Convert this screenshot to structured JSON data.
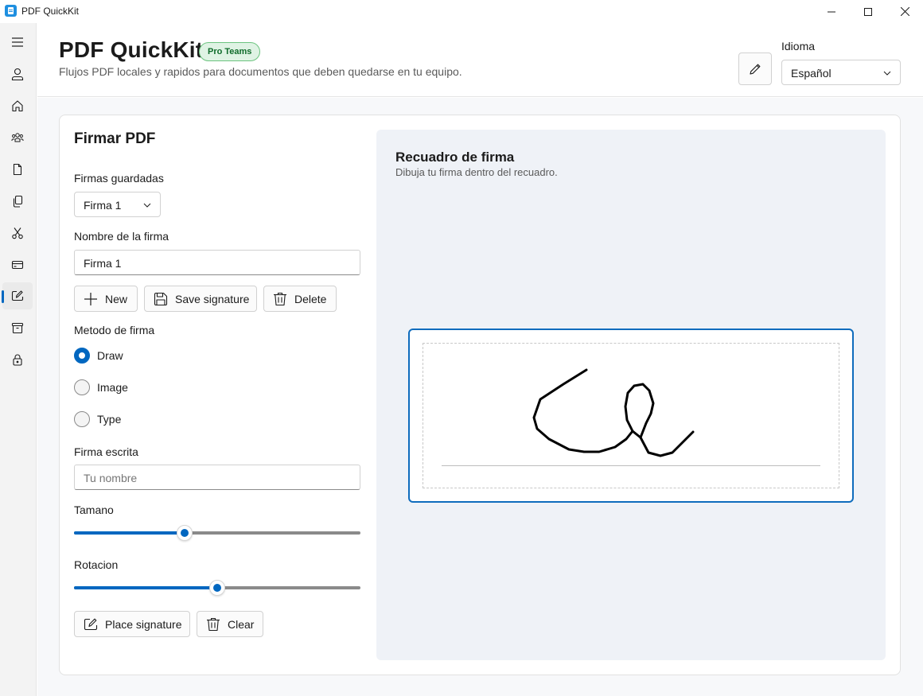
{
  "window": {
    "title": "PDF QuickKit",
    "controls": [
      "minimize",
      "maximize",
      "close"
    ]
  },
  "nav_rail": {
    "items": [
      {
        "icon": "menu-icon"
      },
      {
        "icon": "person-icon"
      },
      {
        "icon": "home-icon"
      },
      {
        "icon": "people-icon"
      },
      {
        "icon": "document-icon"
      },
      {
        "icon": "copy-icon"
      },
      {
        "icon": "scissors-icon"
      },
      {
        "icon": "card-icon"
      },
      {
        "icon": "signature-icon",
        "selected": true
      },
      {
        "icon": "archive-icon"
      },
      {
        "icon": "lock-icon"
      }
    ]
  },
  "header": {
    "title": "PDF QuickKit",
    "badge": "Pro Teams",
    "subtitle": "Flujos PDF locales y rapidos para documentos que deben quedarse en tu equipo.",
    "language_label": "Idioma",
    "language_value": "Español"
  },
  "sign_panel": {
    "title": "Firmar PDF",
    "saved_label": "Firmas guardadas",
    "saved_value": "Firma 1",
    "name_label": "Nombre de la firma",
    "name_value": "Firma 1",
    "buttons": {
      "new": "New",
      "save": "Save signature",
      "delete": "Delete"
    },
    "method_label": "Metodo de firma",
    "methods": [
      {
        "label": "Draw",
        "checked": true
      },
      {
        "label": "Image",
        "checked": false
      },
      {
        "label": "Type",
        "checked": false
      }
    ],
    "typed_label": "Firma escrita",
    "typed_placeholder": "Tu nombre",
    "size_label": "Tamano",
    "size_fraction": 0.385,
    "rotation_label": "Rotacion",
    "rotation_fraction": 0.5,
    "place_button": "Place signature",
    "clear_button": "Clear"
  },
  "signature_pad": {
    "title": "Recuadro de firma",
    "subtitle": "Dibuja tu firma dentro del recuadro."
  },
  "colors": {
    "accent": "#0067c0",
    "pad_border": "#0f6cbd",
    "badge_bg": "#dff3e4",
    "badge_border": "#6cc47f"
  }
}
